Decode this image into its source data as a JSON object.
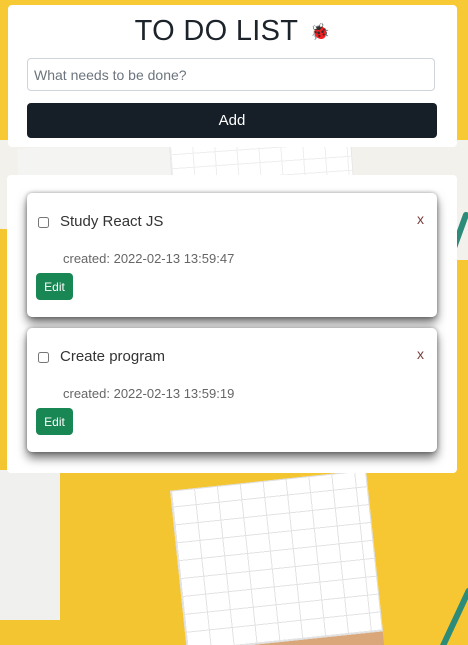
{
  "header": {
    "title": "TO DO LIST",
    "title_icon": "🐞"
  },
  "new_todo": {
    "placeholder": "What needs to be done?",
    "value": "",
    "add_label": "Add"
  },
  "todos": [
    {
      "text": "Study React JS",
      "checked": false,
      "created": "created: 2022-02-13 13:59:47",
      "delete_label": "x",
      "edit_label": "Edit"
    },
    {
      "text": "Create program",
      "checked": false,
      "created": "created: 2022-02-13 13:59:19",
      "delete_label": "x",
      "edit_label": "Edit"
    }
  ],
  "colors": {
    "add_button": "#161f28",
    "edit_button": "#198754",
    "delete_x": "#7a3d3d"
  }
}
